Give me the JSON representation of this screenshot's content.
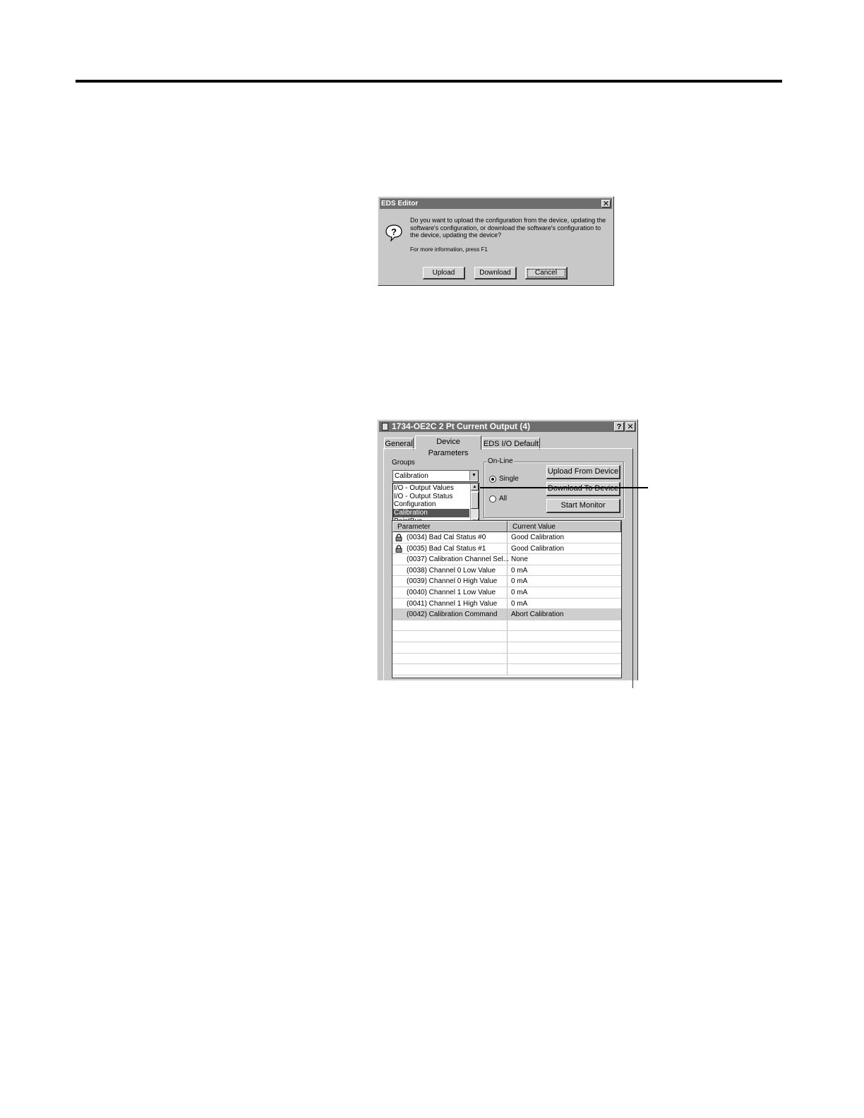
{
  "eds_dialog": {
    "title": "EDS Editor",
    "close_glyph": "✕",
    "icon": "question-icon",
    "message": "Do you want to upload the configuration from the device, updating the software's configuration, or download the software's configuration to the device, updating the device?",
    "more_info": "For more information, press F1",
    "buttons": {
      "upload": "Upload",
      "download": "Download",
      "cancel": "Cancel"
    }
  },
  "device_window": {
    "title": "1734-OE2C 2 Pt Current Output (4)",
    "help_glyph": "?",
    "close_glyph": "✕",
    "tabs": [
      "General",
      "Device Parameters",
      "EDS I/O Default"
    ],
    "active_tab": "Device Parameters",
    "groups_label": "Groups",
    "groups_selected": "Calibration",
    "groups_options": [
      "I/O - Output Values",
      "I/O - Output Status",
      "Configuration",
      "Calibration",
      "PointBus"
    ],
    "online_label": "On-Line",
    "radio_single": "Single",
    "radio_all": "All",
    "buttons": {
      "upload_from_device": "Upload From Device",
      "download_to_device": "Download To Device",
      "start_monitor": "Start Monitor"
    },
    "table": {
      "headers": [
        "Parameter",
        "Current Value"
      ],
      "rows": [
        {
          "param": "(0034) Bad Cal Status #0",
          "value": "Good Calibration",
          "locked": true
        },
        {
          "param": "(0035) Bad Cal Status #1",
          "value": "Good Calibration",
          "locked": true
        },
        {
          "param": "(0037) Calibration Channel Sel...",
          "value": "None",
          "locked": false
        },
        {
          "param": "(0038) Channel 0 Low Value",
          "value": "0 mA",
          "locked": false
        },
        {
          "param": "(0039) Channel 0 High Value",
          "value": "0 mA",
          "locked": false
        },
        {
          "param": "(0040) Channel 1 Low Value",
          "value": "0 mA",
          "locked": false
        },
        {
          "param": "(0041) Channel 1 High Value",
          "value": "0 mA",
          "locked": false
        },
        {
          "param": "(0042) Calibration Command",
          "value": "Abort Calibration",
          "locked": false
        }
      ],
      "selected_row": 7
    }
  }
}
